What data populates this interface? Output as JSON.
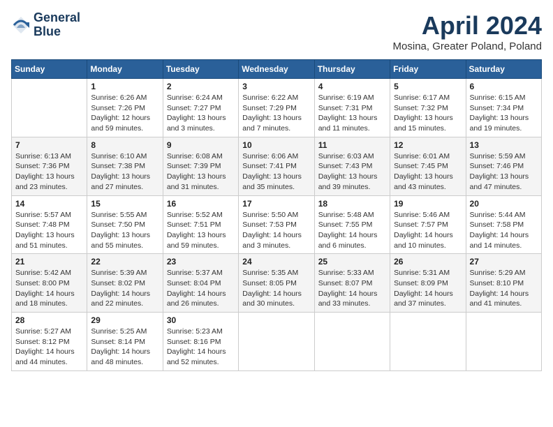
{
  "header": {
    "logo_line1": "General",
    "logo_line2": "Blue",
    "month_title": "April 2024",
    "location": "Mosina, Greater Poland, Poland"
  },
  "weekdays": [
    "Sunday",
    "Monday",
    "Tuesday",
    "Wednesday",
    "Thursday",
    "Friday",
    "Saturday"
  ],
  "weeks": [
    [
      {
        "day": "",
        "text": ""
      },
      {
        "day": "1",
        "text": "Sunrise: 6:26 AM\nSunset: 7:26 PM\nDaylight: 12 hours\nand 59 minutes."
      },
      {
        "day": "2",
        "text": "Sunrise: 6:24 AM\nSunset: 7:27 PM\nDaylight: 13 hours\nand 3 minutes."
      },
      {
        "day": "3",
        "text": "Sunrise: 6:22 AM\nSunset: 7:29 PM\nDaylight: 13 hours\nand 7 minutes."
      },
      {
        "day": "4",
        "text": "Sunrise: 6:19 AM\nSunset: 7:31 PM\nDaylight: 13 hours\nand 11 minutes."
      },
      {
        "day": "5",
        "text": "Sunrise: 6:17 AM\nSunset: 7:32 PM\nDaylight: 13 hours\nand 15 minutes."
      },
      {
        "day": "6",
        "text": "Sunrise: 6:15 AM\nSunset: 7:34 PM\nDaylight: 13 hours\nand 19 minutes."
      }
    ],
    [
      {
        "day": "7",
        "text": "Sunrise: 6:13 AM\nSunset: 7:36 PM\nDaylight: 13 hours\nand 23 minutes."
      },
      {
        "day": "8",
        "text": "Sunrise: 6:10 AM\nSunset: 7:38 PM\nDaylight: 13 hours\nand 27 minutes."
      },
      {
        "day": "9",
        "text": "Sunrise: 6:08 AM\nSunset: 7:39 PM\nDaylight: 13 hours\nand 31 minutes."
      },
      {
        "day": "10",
        "text": "Sunrise: 6:06 AM\nSunset: 7:41 PM\nDaylight: 13 hours\nand 35 minutes."
      },
      {
        "day": "11",
        "text": "Sunrise: 6:03 AM\nSunset: 7:43 PM\nDaylight: 13 hours\nand 39 minutes."
      },
      {
        "day": "12",
        "text": "Sunrise: 6:01 AM\nSunset: 7:45 PM\nDaylight: 13 hours\nand 43 minutes."
      },
      {
        "day": "13",
        "text": "Sunrise: 5:59 AM\nSunset: 7:46 PM\nDaylight: 13 hours\nand 47 minutes."
      }
    ],
    [
      {
        "day": "14",
        "text": "Sunrise: 5:57 AM\nSunset: 7:48 PM\nDaylight: 13 hours\nand 51 minutes."
      },
      {
        "day": "15",
        "text": "Sunrise: 5:55 AM\nSunset: 7:50 PM\nDaylight: 13 hours\nand 55 minutes."
      },
      {
        "day": "16",
        "text": "Sunrise: 5:52 AM\nSunset: 7:51 PM\nDaylight: 13 hours\nand 59 minutes."
      },
      {
        "day": "17",
        "text": "Sunrise: 5:50 AM\nSunset: 7:53 PM\nDaylight: 14 hours\nand 3 minutes."
      },
      {
        "day": "18",
        "text": "Sunrise: 5:48 AM\nSunset: 7:55 PM\nDaylight: 14 hours\nand 6 minutes."
      },
      {
        "day": "19",
        "text": "Sunrise: 5:46 AM\nSunset: 7:57 PM\nDaylight: 14 hours\nand 10 minutes."
      },
      {
        "day": "20",
        "text": "Sunrise: 5:44 AM\nSunset: 7:58 PM\nDaylight: 14 hours\nand 14 minutes."
      }
    ],
    [
      {
        "day": "21",
        "text": "Sunrise: 5:42 AM\nSunset: 8:00 PM\nDaylight: 14 hours\nand 18 minutes."
      },
      {
        "day": "22",
        "text": "Sunrise: 5:39 AM\nSunset: 8:02 PM\nDaylight: 14 hours\nand 22 minutes."
      },
      {
        "day": "23",
        "text": "Sunrise: 5:37 AM\nSunset: 8:04 PM\nDaylight: 14 hours\nand 26 minutes."
      },
      {
        "day": "24",
        "text": "Sunrise: 5:35 AM\nSunset: 8:05 PM\nDaylight: 14 hours\nand 30 minutes."
      },
      {
        "day": "25",
        "text": "Sunrise: 5:33 AM\nSunset: 8:07 PM\nDaylight: 14 hours\nand 33 minutes."
      },
      {
        "day": "26",
        "text": "Sunrise: 5:31 AM\nSunset: 8:09 PM\nDaylight: 14 hours\nand 37 minutes."
      },
      {
        "day": "27",
        "text": "Sunrise: 5:29 AM\nSunset: 8:10 PM\nDaylight: 14 hours\nand 41 minutes."
      }
    ],
    [
      {
        "day": "28",
        "text": "Sunrise: 5:27 AM\nSunset: 8:12 PM\nDaylight: 14 hours\nand 44 minutes."
      },
      {
        "day": "29",
        "text": "Sunrise: 5:25 AM\nSunset: 8:14 PM\nDaylight: 14 hours\nand 48 minutes."
      },
      {
        "day": "30",
        "text": "Sunrise: 5:23 AM\nSunset: 8:16 PM\nDaylight: 14 hours\nand 52 minutes."
      },
      {
        "day": "",
        "text": ""
      },
      {
        "day": "",
        "text": ""
      },
      {
        "day": "",
        "text": ""
      },
      {
        "day": "",
        "text": ""
      }
    ]
  ]
}
